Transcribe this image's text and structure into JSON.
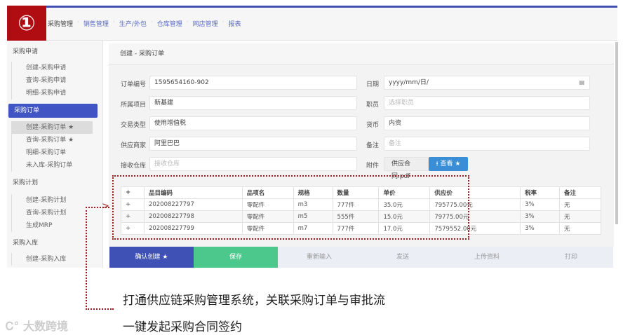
{
  "badge": "①",
  "nav": [
    "采购管理",
    "销售管理",
    "生产/外包",
    "仓库管理",
    "网店管理",
    "报表"
  ],
  "sidebar": {
    "groups": [
      {
        "label": "采购申请",
        "items": [
          "创建-采购申请",
          "查询-采购申请",
          "明细-采购申请"
        ]
      },
      {
        "label": "采购订单",
        "items": [
          "创建-采购订单 ★",
          "查询-采购订单 ★",
          "明细-采购订单",
          "未入库-采购订单"
        ]
      },
      {
        "label": "采购计划",
        "items": [
          "创建-采购计划",
          "查询-采购计划",
          "生成MRP"
        ]
      },
      {
        "label": "采购入库",
        "items": [
          "创建-采购入库"
        ]
      }
    ]
  },
  "page_title": "创建 - 采购订单",
  "form": {
    "order_no_label": "订单编号",
    "order_no": "1595654160-902",
    "project_label": "所属项目",
    "project": "新基建",
    "trade_label": "交易类型",
    "trade": "使用增值税",
    "supplier_label": "供应商家",
    "supplier": "阿里巴巴",
    "warehouse_label": "接收仓库",
    "warehouse_ph": "接收仓库",
    "date_label": "日期",
    "date": "yyyy/mm/日/",
    "staff_label": "职员",
    "staff_ph": "选择职员",
    "currency_label": "货币",
    "currency": "内资",
    "note_label": "备注",
    "note_ph": "备注",
    "attach_label": "附件",
    "attach_file": "供应合同.pdf",
    "view_btn": "查看 ★"
  },
  "table": {
    "headers": [
      "+",
      "品目编码",
      "品项名",
      "规格",
      "数量",
      "单价",
      "供应价",
      "税率",
      "备注"
    ],
    "rows": [
      [
        "+",
        "202008227797",
        "零配件",
        "m3",
        "777件",
        "35.0元",
        "795775.00元",
        "3%",
        "无"
      ],
      [
        "+",
        "202008227798",
        "零配件",
        "m5",
        "555件",
        "15.0元",
        "79775.00元",
        "3%",
        "无"
      ],
      [
        "+",
        "202008227799",
        "零配件",
        "m7",
        "777件",
        "17.0元",
        "7579552.00元",
        "3%",
        "无"
      ]
    ]
  },
  "buttons": [
    "确认创建 ★",
    "保存",
    "重新输入",
    "发送",
    "上传资料",
    "打印"
  ],
  "caption": [
    "打通供应链采购管理系统，关联采购订单与审批流",
    "一键发起采购合同签约"
  ],
  "watermark": "大数跨境"
}
